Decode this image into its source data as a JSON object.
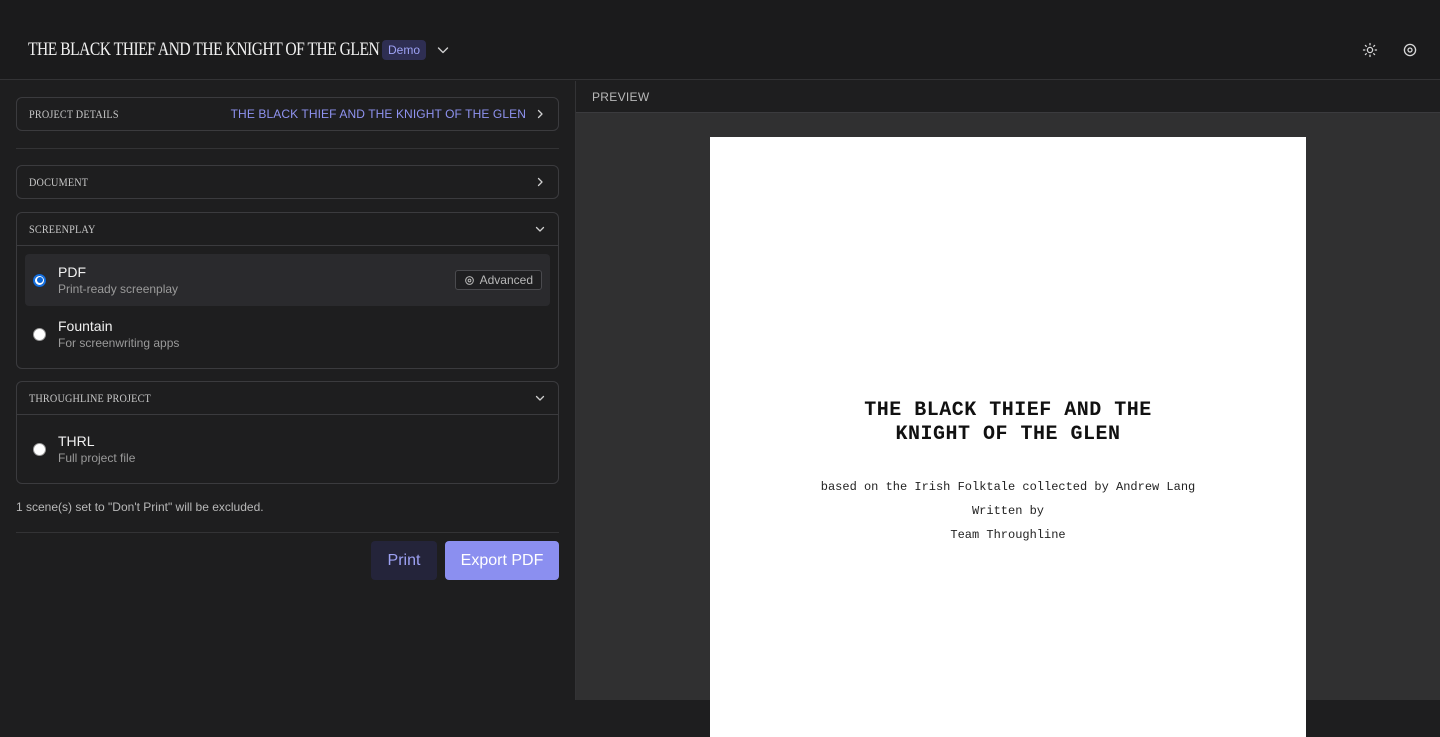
{
  "header": {
    "title": "THE BLACK THIEF AND THE KNIGHT OF THE GLEN",
    "badge": "Demo",
    "icons": [
      "chevron-down-icon",
      "sun-icon",
      "settings-icon"
    ]
  },
  "sections": {
    "project_details": {
      "title": "PROJECT DETAILS",
      "value": "THE BLACK THIEF AND THE KNIGHT OF THE GLEN"
    },
    "document": {
      "title": "DOCUMENT"
    },
    "screenplay": {
      "title": "SCREENPLAY",
      "options": [
        {
          "label": "PDF",
          "desc": "Print-ready screenplay",
          "selected": true,
          "advanced_label": "Advanced"
        },
        {
          "label": "Fountain",
          "desc": "For screenwriting apps",
          "selected": false
        }
      ]
    },
    "throughline": {
      "title": "THROUGHLINE PROJECT",
      "options": [
        {
          "label": "THRL",
          "desc": "Full project file",
          "selected": false
        }
      ]
    }
  },
  "note": "1 scene(s) set to \"Don't Print\" will be excluded.",
  "buttons": {
    "print": "Print",
    "export": "Export PDF"
  },
  "preview": {
    "label": "PREVIEW",
    "title_line1": "THE BLACK THIEF AND THE",
    "title_line2": "KNIGHT OF THE GLEN",
    "based_on": "based on the Irish Folktale collected by Andrew Lang",
    "written_by": "Written by",
    "author": "Team Throughline"
  },
  "colors": {
    "accent": "#8b8ff0",
    "link": "#8f93f0",
    "background": "#1e1e1f",
    "preview_bg": "#303031"
  }
}
